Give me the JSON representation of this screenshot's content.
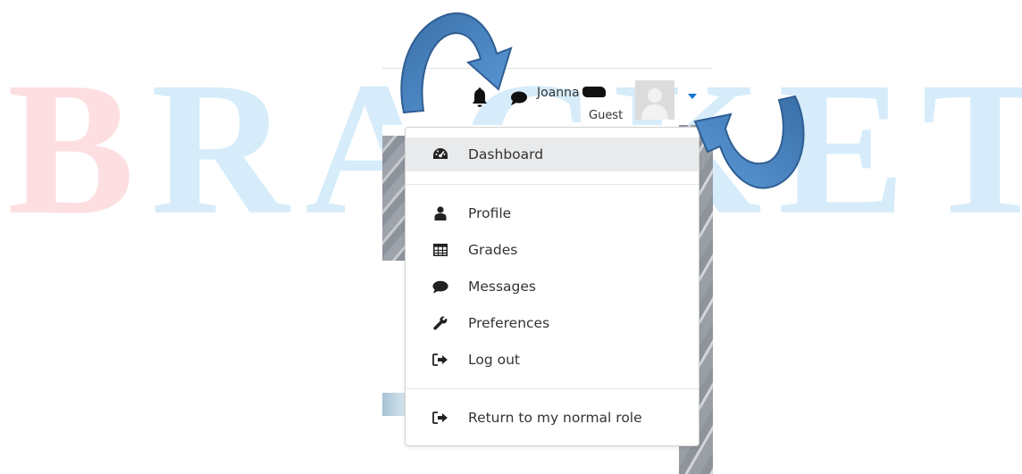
{
  "watermark": {
    "first_letter": "B",
    "rest": "RACKET"
  },
  "header": {
    "user_name": "Joanna",
    "role": "Guest",
    "icons": [
      "bell-icon",
      "chat-icon",
      "caret-down-icon"
    ]
  },
  "menu": {
    "items": [
      {
        "label": "Dashboard",
        "icon": "dashboard-icon",
        "active": true
      },
      {
        "label": "Profile",
        "icon": "user-icon"
      },
      {
        "label": "Grades",
        "icon": "table-icon"
      },
      {
        "label": "Messages",
        "icon": "comment-icon"
      },
      {
        "label": "Preferences",
        "icon": "wrench-icon"
      },
      {
        "label": "Log out",
        "icon": "sign-out-icon"
      },
      {
        "label": "Return to my normal role",
        "icon": "sign-out-icon"
      }
    ]
  },
  "colors": {
    "caret": "#1177d1",
    "arrow": "#4a89c8",
    "watermark_first": "#fddfe2",
    "watermark_rest": "#d6ecfa",
    "active_item_bg": "#e8eaec"
  }
}
